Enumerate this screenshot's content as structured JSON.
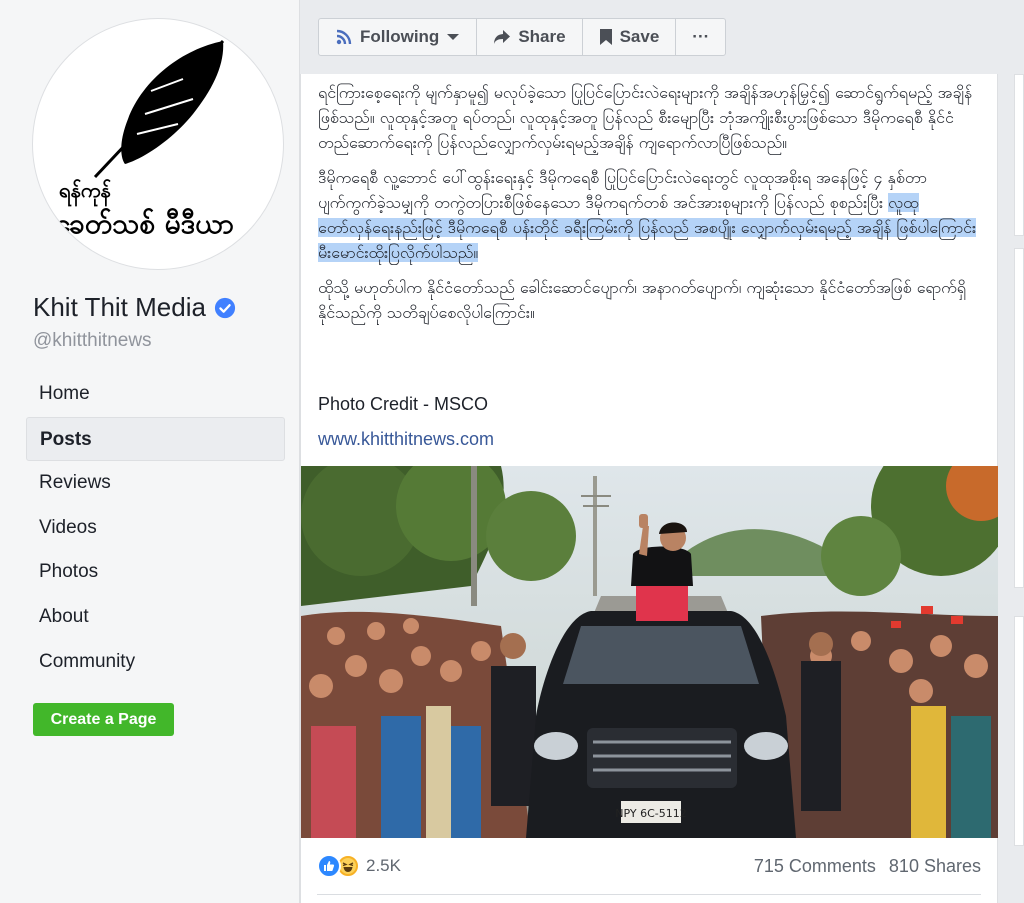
{
  "page": {
    "logo_line1": "ရန်ကုန်",
    "logo_line2": "ခေတ်သစ် မီဒီယာ",
    "name": "Khit Thit Media",
    "handle": "@khitthitnews",
    "verified_icon": "verified-badge-icon"
  },
  "nav": {
    "items": [
      {
        "label": "Home"
      },
      {
        "label": "Posts"
      },
      {
        "label": "Reviews"
      },
      {
        "label": "Videos"
      },
      {
        "label": "Photos"
      },
      {
        "label": "About"
      },
      {
        "label": "Community"
      }
    ],
    "active": "Posts",
    "create_page": "Create a Page"
  },
  "actionbar": {
    "following": "Following",
    "share": "Share",
    "save": "Save",
    "more": "···"
  },
  "post": {
    "p1": "ရင်ကြားစေ့ရေးကို မျက်နှာမူ၍ မလုပ်ခဲ့သော ပြုပြင်ပြောင်းလဲရေးများကို အချိန်အဟုန်မြှင့်၍ ဆောင်ရွက်ရမည့် အချိန်ဖြစ်သည်။ လူထုနှင့်အတူ ရပ်တည်၊ လူထုနှင့်အတူ ပြန်လည် စီးမျောပြီး ဘုံအကျိုးစီးပွားဖြစ်သော ဒီမိုကရေစီ နိုင်ငံတည်ဆောက်ရေးကို ပြန်လည်လျှောက်လှမ်းရမည့်အချိန် ကျရောက်လာပြီဖြစ်သည်။",
    "p2_a": "ဒီမိုကရေစီ လူ့ဘောင် ပေါ်ထွန်းရေးနှင့် ဒီမိုကရေစီ ပြုပြင်ပြောင်းလဲရေးတွင် လူထုအစိုးရ အနေဖြင့် ၄ နှစ်တာ ပျက်ကွက်ခဲ့သမျှကို တကွဲတပြားစီဖြစ်နေသော ဒီမိုကရက်တစ် အင်အားစုများကို ပြန်လည် စုစည်းပြီး ",
    "p2_b": "လူထုတော်လှန်ရေးနည်းဖြင့် ဒီမိုကရေစီ ပန်းတိုင် ခရီးကြမ်းကို ပြန်လည် အစပျိုး လျှောက်လှမ်းရမည့် အချိန် ဖြစ်ပါကြောင်း မီးမောင်းထိုးပြလိုက်ပါသည်။",
    "p3": "ထိုသို့ မဟုတ်ပါက နိုင်ငံတော်သည် ခေါင်းဆောင်ပျောက်၊ အနာဂတ်ပျောက်၊ ကျဆုံးသော နိုင်ငံတော်အဖြစ် ရောက်ရှိနိုင်သည်ကို သတိချပ်စေလိုပါကြောင်း။",
    "credit": "Photo Credit - MSCO",
    "link": "www.khitthitnews.com",
    "plate": "NPY 6C-5112"
  },
  "footer": {
    "reaction_count": "2.5K",
    "comments": "715 Comments",
    "shares": "810 Shares",
    "reaction_icons": [
      "like-icon",
      "haha-icon"
    ]
  },
  "colors": {
    "fb_blue": "#385898",
    "green": "#42b72a",
    "highlight": "#b5d3f7"
  }
}
